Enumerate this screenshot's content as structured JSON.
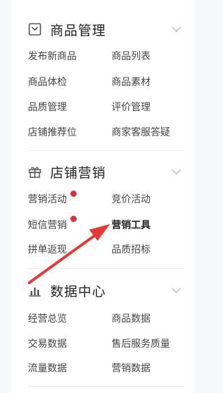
{
  "sections": [
    {
      "title": "商品管理",
      "icon": "product-box-icon",
      "items": [
        "发布新商品",
        "商品列表",
        "商品体检",
        "商品素材",
        "品质管理",
        "评价管理",
        "店铺推荐位",
        "商家客服答疑"
      ]
    },
    {
      "title": "店铺营销",
      "icon": "gift-icon",
      "items": [
        "营销活动",
        "竞价活动",
        "短信营销",
        "营销工具",
        "拼单返现",
        "品质招标"
      ]
    },
    {
      "title": "数据中心",
      "icon": "bar-chart-icon",
      "items": [
        "经营总览",
        "商品数据",
        "交易数据",
        "售后服务质量",
        "流量数据",
        "营销数据"
      ]
    }
  ],
  "colors": {
    "badge": "#e02e3c",
    "arrow": "#e53935"
  }
}
